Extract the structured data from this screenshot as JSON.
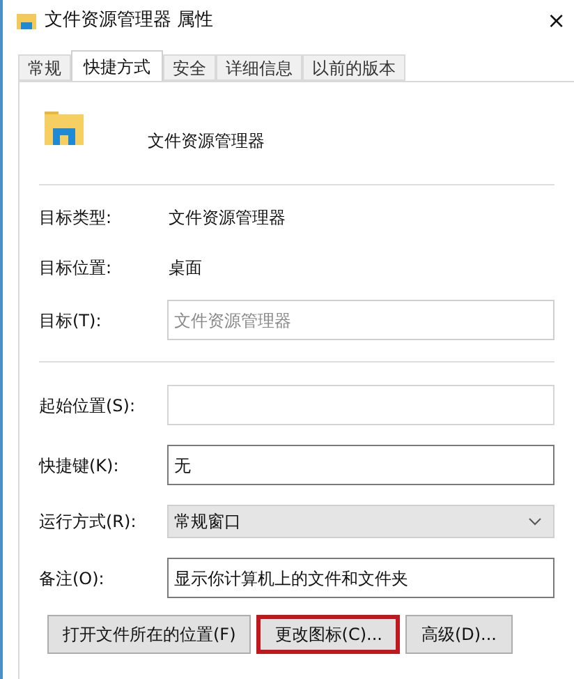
{
  "window": {
    "title": "文件资源管理器 属性",
    "close": "×"
  },
  "tabs": [
    {
      "label": "常规",
      "selected": false
    },
    {
      "label": "快捷方式",
      "selected": true
    },
    {
      "label": "安全",
      "selected": false
    },
    {
      "label": "详细信息",
      "selected": false
    },
    {
      "label": "以前的版本",
      "selected": false
    }
  ],
  "shortcut_name": "文件资源管理器",
  "info": [
    {
      "label": "目标类型:",
      "value": "文件资源管理器"
    },
    {
      "label": "目标位置:",
      "value": "桌面"
    }
  ],
  "target": {
    "label": "目标(T):",
    "value": "文件资源管理器",
    "disabled": true
  },
  "fields": [
    {
      "kind": "text",
      "label": "起始位置(S):",
      "disabled": true
    },
    {
      "kind": "text",
      "label": "快捷键(K):",
      "value": "无",
      "disabled": false
    },
    {
      "kind": "select",
      "label": "运行方式(R):",
      "value": "常规窗口"
    },
    {
      "kind": "text",
      "label": "备注(O):",
      "value": "显示你计算机上的文件和文件夹",
      "disabled": false
    }
  ],
  "buttons": [
    {
      "label": "打开文件所在的位置(F)",
      "highlighted": false
    },
    {
      "label": "更改图标(C)...",
      "highlighted": true
    },
    {
      "label": "高级(D)...",
      "highlighted": false
    }
  ]
}
